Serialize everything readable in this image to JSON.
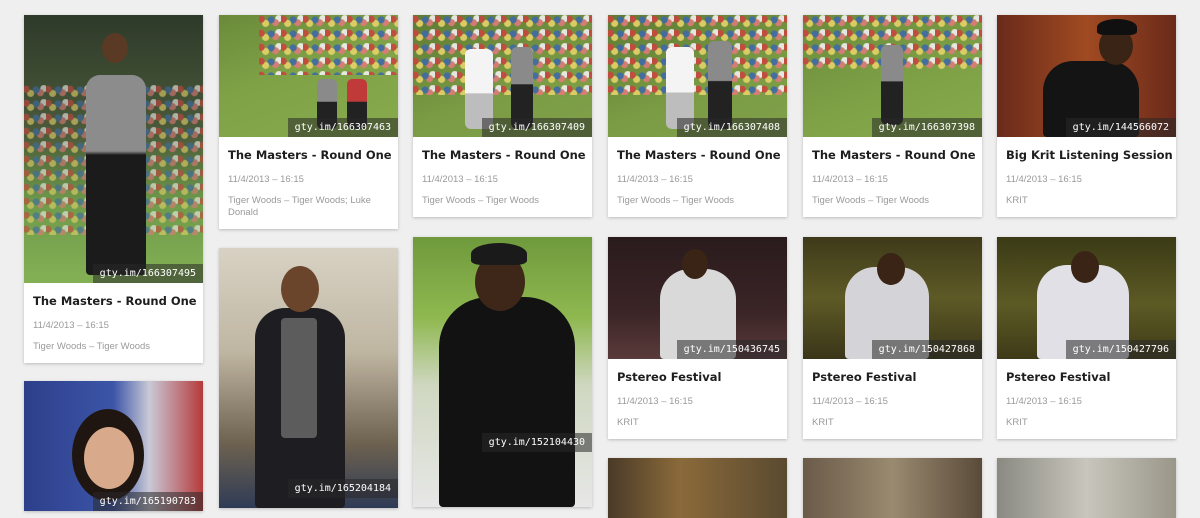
{
  "cards": [
    {
      "shortlink": "gty.im/166307495",
      "title": "The Masters - Round One",
      "date": "11/4/2013 – 16:15",
      "tags": "Tiger Woods – Tiger Woods"
    },
    {
      "shortlink": "gty.im/165190783"
    },
    {
      "shortlink": "gty.im/166307463",
      "title": "The Masters - Round One",
      "date": "11/4/2013 – 16:15",
      "tags": "Tiger Woods – Tiger Woods; Luke Donald"
    },
    {
      "shortlink": "gty.im/165204184"
    },
    {
      "shortlink": "gty.im/166307409",
      "title": "The Masters - Round One",
      "date": "11/4/2013 – 16:15",
      "tags": "Tiger Woods – Tiger Woods"
    },
    {
      "shortlink": "gty.im/152104430"
    },
    {
      "shortlink": "gty.im/166307408",
      "title": "The Masters - Round One",
      "date": "11/4/2013 – 16:15",
      "tags": "Tiger Woods – Tiger Woods"
    },
    {
      "shortlink": "gty.im/150436745",
      "title": "Pstereo Festival",
      "date": "11/4/2013 – 16:15",
      "tags": "KRIT"
    },
    {
      "shortlink": "gty.im/166307398",
      "title": "The Masters - Round One",
      "date": "11/4/2013 – 16:15",
      "tags": "Tiger Woods – Tiger Woods"
    },
    {
      "shortlink": "gty.im/150427868",
      "title": "Pstereo Festival",
      "date": "11/4/2013 – 16:15",
      "tags": "KRIT"
    },
    {
      "shortlink": "gty.im/144566072",
      "title": "Big Krit Listening Session",
      "date": "11/4/2013 – 16:15",
      "tags": "KRIT"
    },
    {
      "shortlink": "gty.im/150427796",
      "title": "Pstereo Festival",
      "date": "11/4/2013 – 16:15",
      "tags": "KRIT"
    }
  ]
}
